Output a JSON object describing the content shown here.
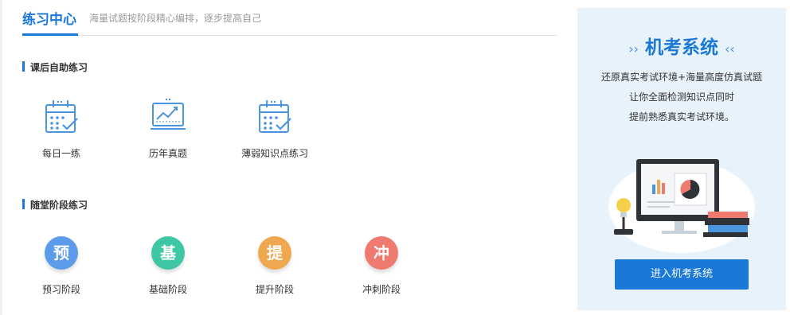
{
  "header": {
    "title": "练习中心",
    "subtitle": "海量试题按阶段精心编排，逐步提高自己"
  },
  "section_self": {
    "title": "课后自助练习",
    "items": [
      {
        "label": "每日一练",
        "icon": "calendar-check-icon"
      },
      {
        "label": "历年真题",
        "icon": "trend-chart-icon"
      },
      {
        "label": "薄弱知识点练习",
        "icon": "calendar-check-icon"
      }
    ]
  },
  "section_stage": {
    "title": "随堂阶段练习",
    "items": [
      {
        "char": "预",
        "label": "预习阶段",
        "color": "#5b9bea"
      },
      {
        "char": "基",
        "label": "基础阶段",
        "color": "#3fc6a5"
      },
      {
        "char": "提",
        "label": "提升阶段",
        "color": "#f0a850"
      },
      {
        "char": "冲",
        "label": "冲刺阶段",
        "color": "#ef7b70"
      }
    ]
  },
  "exam": {
    "left_arrows": "››",
    "title": "机考系统",
    "right_arrows": "‹‹",
    "desc_line1": "还原真实考试环境+海量高度仿真试题",
    "desc_line2": "让你全面检测知识点同时",
    "desc_line3": "提前熟悉真实考试环境。",
    "button_label": "进入机考系统"
  },
  "colors": {
    "accent": "#1a78d8",
    "panel_bg": "#e8f2fb",
    "icon_blue": "#4a95e0"
  }
}
